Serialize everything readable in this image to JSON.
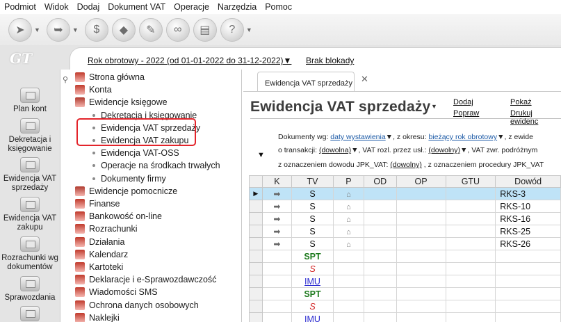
{
  "menu": [
    "Podmiot",
    "Widok",
    "Dodaj",
    "Dokument VAT",
    "Operacje",
    "Narzędzia",
    "Pomoc"
  ],
  "toolbar_icons": [
    "back-icon",
    "forward-icon",
    "money-icon",
    "eraser-icon",
    "tools-icon",
    "link-icon",
    "print-icon",
    "help-icon"
  ],
  "logo": "GT",
  "header": {
    "year": "Rok obrotowy - 2022  (od 01-01-2022 do 31-12-2022)",
    "year_caret": "▼",
    "blockade": "Brak blokady"
  },
  "nav": [
    {
      "label": "Plan kont"
    },
    {
      "label": "Dekretacja i księgowanie"
    },
    {
      "label": "Ewidencja VAT sprzedaży"
    },
    {
      "label": "Ewidencja VAT zakupu"
    },
    {
      "label": "Rozrachunki wg dokumentów"
    },
    {
      "label": "Sprawozdania"
    }
  ],
  "tree": [
    {
      "label": "Strona główna",
      "level": 0,
      "color": "#c0392b"
    },
    {
      "label": "Konta",
      "level": 0,
      "color": "#c0392b"
    },
    {
      "label": "Ewidencje księgowe",
      "level": 0,
      "color": "#b03a2e"
    },
    {
      "label": "Dekretacja i księgowanie",
      "level": 1
    },
    {
      "label": "Ewidencja VAT sprzedaży",
      "level": 1
    },
    {
      "label": "Ewidencja VAT zakupu",
      "level": 1
    },
    {
      "label": "Ewidencja VAT-OSS",
      "level": 1
    },
    {
      "label": "Operacje na środkach trwałych",
      "level": 1
    },
    {
      "label": "Dokumenty firmy",
      "level": 1
    },
    {
      "label": "Ewidencje pomocnicze",
      "level": 0,
      "color": "#b03a2e"
    },
    {
      "label": "Finanse",
      "level": 0,
      "color": "#c0392b"
    },
    {
      "label": "Bankowość on-line",
      "level": 0,
      "color": "#c0392b"
    },
    {
      "label": "Rozrachunki",
      "level": 0,
      "color": "#c0392b"
    },
    {
      "label": "Działania",
      "level": 0,
      "color": "#c0392b"
    },
    {
      "label": "Kalendarz",
      "level": 0,
      "color": "#c0392b"
    },
    {
      "label": "Kartoteki",
      "level": 0,
      "color": "#c0392b"
    },
    {
      "label": "Deklaracje i e-Sprawozdawczość",
      "level": 0,
      "color": "#c0392b"
    },
    {
      "label": "Wiadomości SMS",
      "level": 0,
      "color": "#c0392b"
    },
    {
      "label": "Ochrona danych osobowych",
      "level": 0,
      "color": "#c0392b"
    },
    {
      "label": "Naklejki",
      "level": 0,
      "color": "#c0392b"
    }
  ],
  "tab": {
    "label": "Ewidencja VAT sprzedaży",
    "close": "✕"
  },
  "page": {
    "title": "Ewidencja VAT sprzedaży",
    "actions": [
      "Dodaj",
      "Popraw",
      "Pokaż",
      "Drukuj ewidenc"
    ]
  },
  "filters": {
    "line1": {
      "prefix": "Dokumenty wg:",
      "by": "daty wystawienia",
      "mid": ", z okresu:",
      "period": "bieżący rok obrotowy",
      "suffix": ", z ewide"
    },
    "line2": {
      "prefix": "o transakcji:",
      "trans": "(dowolna)",
      "mid": ", VAT rozl. przez usł.:",
      "vat": "(dowolny)",
      "suffix": ", VAT zwr. podróżnym"
    },
    "line3": {
      "prefix": "z oznaczeniem dowodu JPK_VAT:",
      "jpk": "(dowolny)",
      "suffix": ", z oznaczeniem procedury JPK_VAT"
    }
  },
  "grid": {
    "columns": [
      "K",
      "TV",
      "P",
      "OD",
      "OP",
      "GTU",
      "Dowód"
    ],
    "rows": [
      {
        "k": "arrow",
        "tv": "S",
        "p": "home",
        "dowod": "RKS-3",
        "selected": true
      },
      {
        "k": "arrow",
        "tv": "S",
        "p": "home",
        "dowod": "RKS-10"
      },
      {
        "k": "arrow",
        "tv": "S",
        "p": "home",
        "dowod": "RKS-16"
      },
      {
        "k": "arrow",
        "tv": "S",
        "p": "home",
        "dowod": "RKS-25"
      },
      {
        "k": "arrow",
        "tv": "S",
        "p": "home",
        "dowod": "RKS-26"
      },
      {
        "k": "",
        "tv": "SPT",
        "tvstyle": "spt",
        "p": "",
        "dowod": ""
      },
      {
        "k": "",
        "tv": "S",
        "tvstyle": "sred",
        "p": "",
        "dowod": ""
      },
      {
        "k": "",
        "tv": "IMU",
        "tvstyle": "imu",
        "p": "",
        "dowod": ""
      },
      {
        "k": "",
        "tv": "SPT",
        "tvstyle": "spt",
        "p": "",
        "dowod": ""
      },
      {
        "k": "",
        "tv": "S",
        "tvstyle": "sred",
        "p": "",
        "dowod": ""
      },
      {
        "k": "",
        "tv": "IMU",
        "tvstyle": "imu",
        "p": "",
        "dowod": ""
      }
    ]
  },
  "colors": {
    "highlight": "#e3242b",
    "selected_row": "#bfe3f7",
    "link": "#1c5aa6"
  }
}
